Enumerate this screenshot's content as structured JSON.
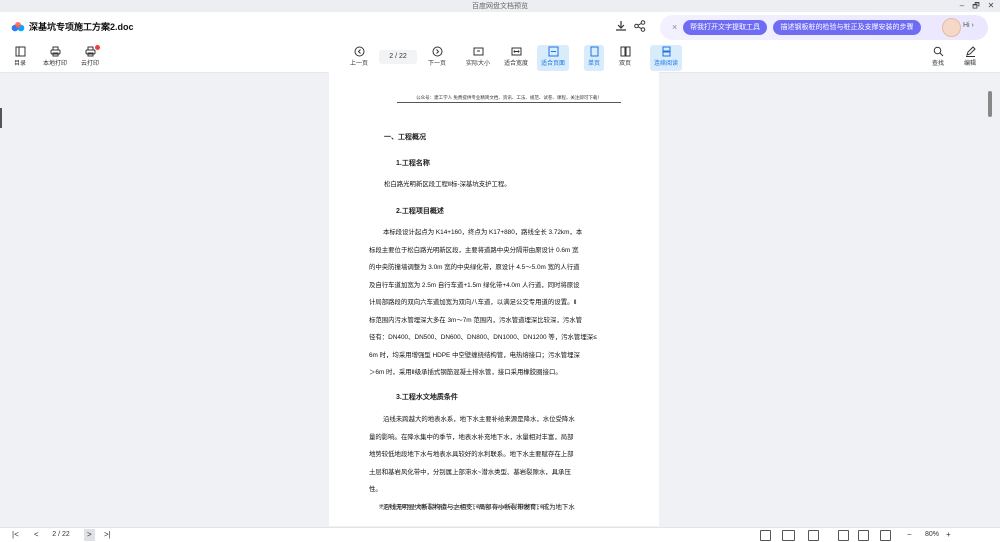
{
  "window": {
    "title": "百度网盘文档预览",
    "controls": [
      "–",
      "🗗",
      "✕"
    ]
  },
  "header": {
    "doc_name": "深基坑专项施工方案2.doc",
    "icons": [
      "download-icon",
      "share-icon"
    ],
    "ai": {
      "close": "×",
      "pill1": "帮我打开文字提取工具",
      "pill2": "描述钢板桩的检验与桩正及支撑安装的步骤",
      "hi": "Hi ›"
    }
  },
  "toolbar": {
    "toc": "目录",
    "local_print": "本地打印",
    "cloud_print": "云打印",
    "prev": "上一页",
    "page": "2 / 22",
    "next": "下一页",
    "actual_size": "实际大小",
    "fit_width": "适合宽度",
    "fit_page": "适合页面",
    "single": "单页",
    "double": "双页",
    "continuous": "连续阅读",
    "find": "查找",
    "edit": "编辑"
  },
  "document": {
    "page_header": "公众号：建工学人 免费提供专业精简文档、资讯、工法、规范、试卷、课程，关注即可下载！",
    "heading1": "一、工程概况",
    "sec1_title": "1.工程名称",
    "sec1_text": "松白路光明新区段工程Ⅱ标-深基坑支护工程。",
    "sec2_title": "2.工程项目概述",
    "sec2_lines": [
      "本标段设计起点为 K14+160，终点为 K17+880，路线全长 3.72km，本",
      "标段主要位于松白路光明新区段，主要将道路中央分隔带由原设计 0.6m 宽",
      "的中央防撞墙调整为 3.0m 宽的中央绿化带，原设计 4.5～5.0m 宽的人行道",
      "及自行车道加宽为 2.5m 自行车道+1.5m 绿化带+4.0m 人行道，同时将原设",
      "计局部路段的双向六车道加宽为双向八车道，以满足公交专用道的设置。Ⅱ",
      "标范围内污水管埋深大多在 3m～7m 范围内，污水管道埋深比较深，污水管",
      "径有：DN400、DN500、DN600、DN800、DN1000、DN1200 等，污水管埋深≤",
      "6m 时，均采用增强型 HDPE 中空壁缠绕结构管，电热熔接口；污水管埋深",
      "＞6m 时，采用Ⅱ级承插式钢筋混凝土排水管，接口采用橡胶圈接口。"
    ],
    "sec3_title": "3.工程水文地质条件",
    "sec3_lines": [
      "沿线未跨越大的地表水系，地下水主要补给来源是降水，水位受降水",
      "量的影响。在降水集中的季节，地表水补充地下水，水量相对丰富，局部",
      "地势较低地段地下水与地表水具较好的水利联系。地下水主要赋存在上部",
      "土层和基岩风化带中，分别属上部滞水~潜水类型、基岩裂隙水，具承压",
      "性。",
      "沿线无明显大断裂构造与之相交，局部有小断裂带发育，成为地下水"
    ],
    "page_footer": "更多专业资料 标书 图集 方案 视频、CAD 软件下载查询：wdzyk.com 直接得存下载！"
  },
  "status": {
    "first": "|<",
    "prev": "<",
    "page": "2 / 22",
    "next": ">",
    "last": ">|",
    "minus": "−",
    "zoom": "80%",
    "plus": "+"
  }
}
